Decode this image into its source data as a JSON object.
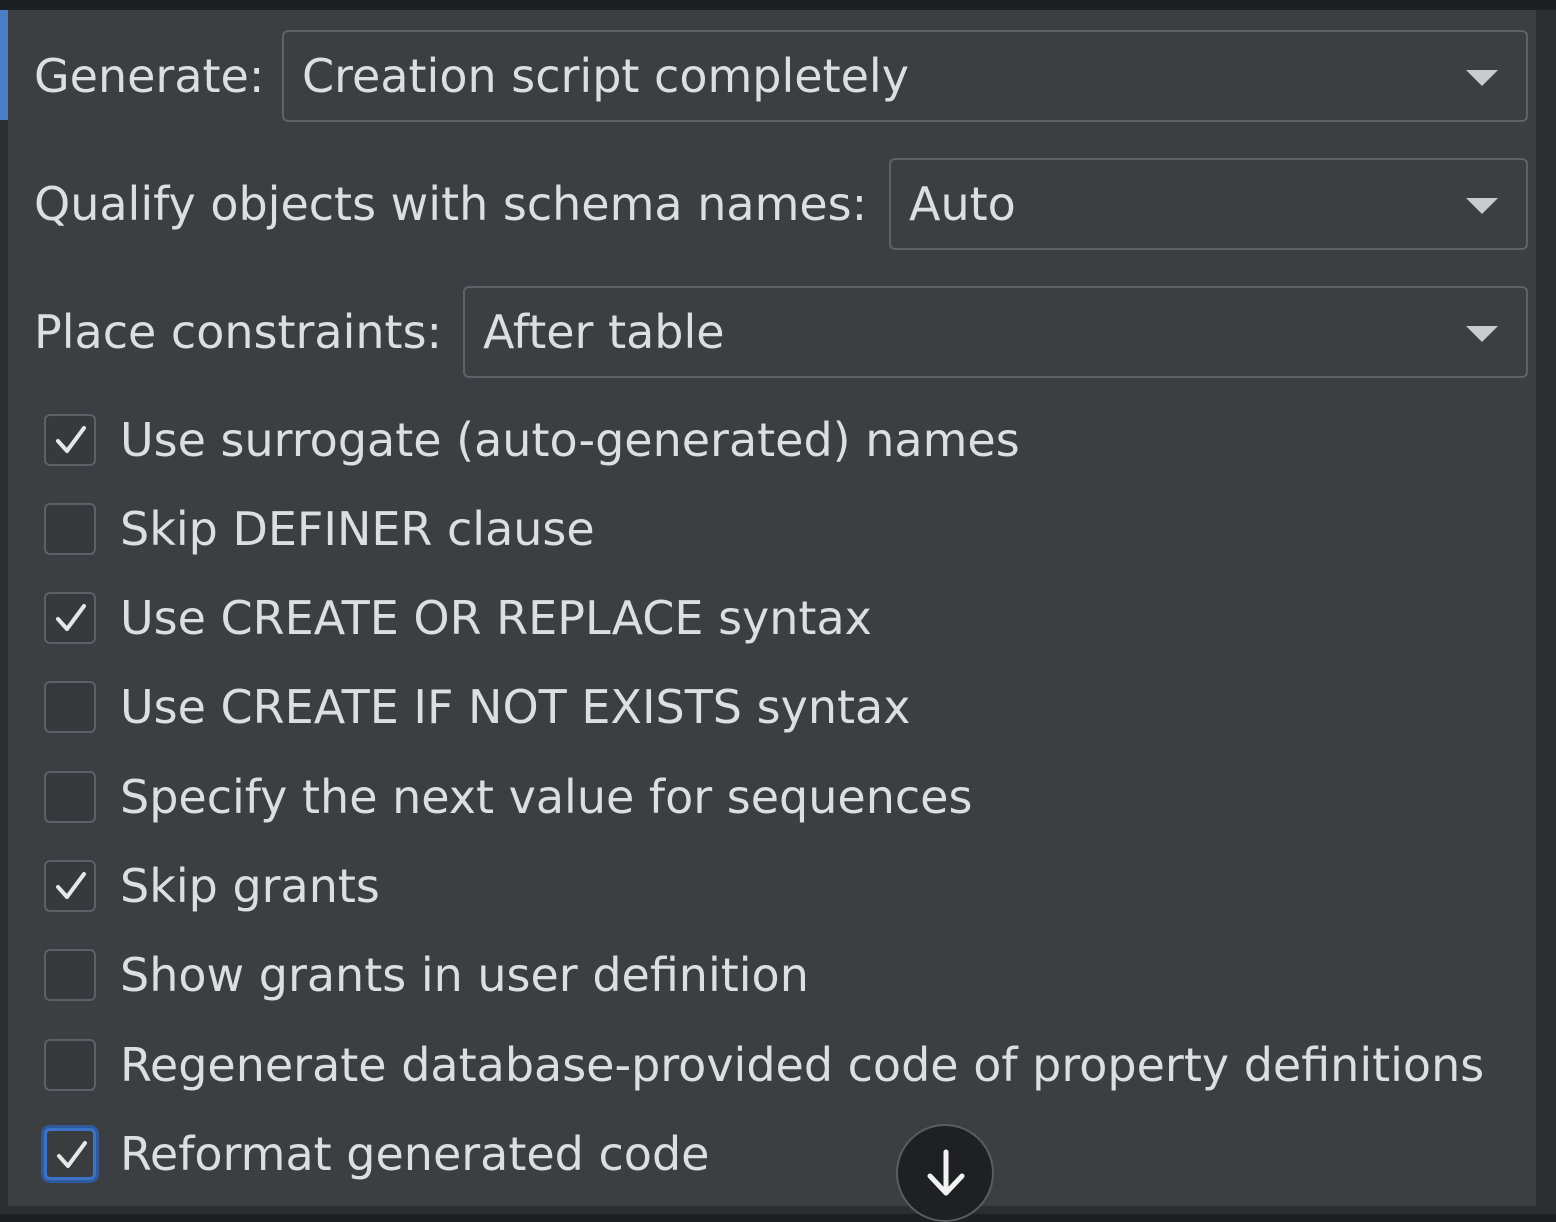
{
  "options": {
    "generate": {
      "label": "Generate:",
      "value": "Creation script completely"
    },
    "qualify": {
      "label": "Qualify objects with schema names:",
      "value": "Auto"
    },
    "constraints": {
      "label": "Place constraints:",
      "value": "After table"
    },
    "checkboxes": [
      {
        "label": "Use surrogate (auto-generated) names",
        "checked": true
      },
      {
        "label": "Skip DEFINER clause",
        "checked": false
      },
      {
        "label": "Use CREATE OR REPLACE syntax",
        "checked": true
      },
      {
        "label": "Use CREATE IF NOT EXISTS syntax",
        "checked": false
      },
      {
        "label": "Specify the next value for sequences",
        "checked": false
      },
      {
        "label": "Skip grants",
        "checked": true
      },
      {
        "label": "Show grants in user definition",
        "checked": false
      },
      {
        "label": "Regenerate database-provided code of property definitions",
        "checked": false
      },
      {
        "label": "Reformat generated code",
        "checked": true
      }
    ]
  },
  "icons": {
    "combo_arrow": "chevron-down-icon",
    "check": "check-icon",
    "scroll_down": "arrow-down-icon"
  },
  "colors": {
    "panel_bg": "#3c3f41",
    "accent": "#4a7fc8",
    "focus_ring": "#3d73c7"
  }
}
